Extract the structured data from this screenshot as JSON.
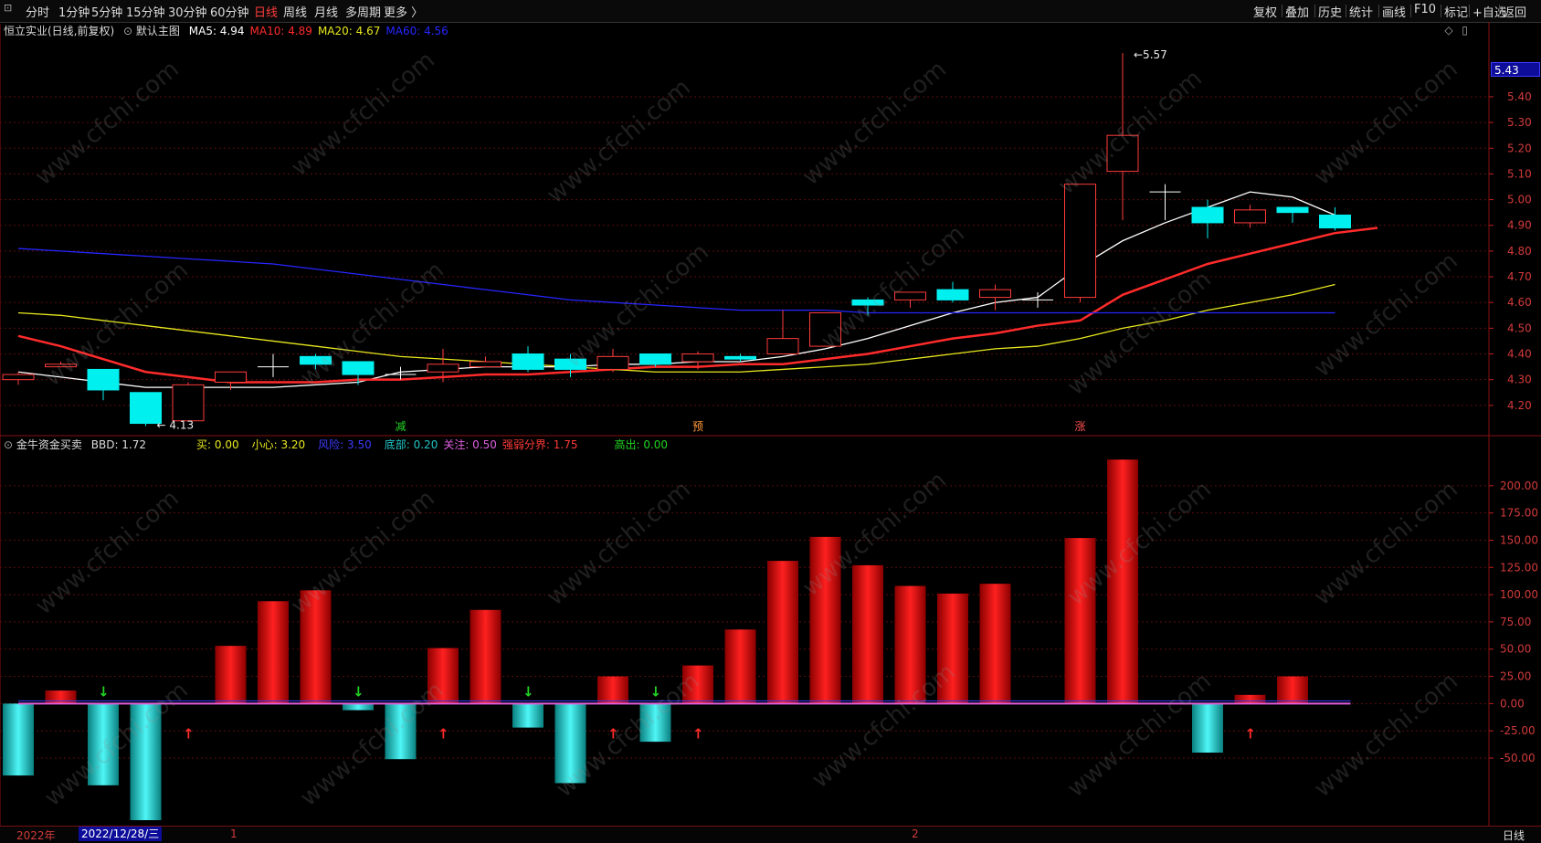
{
  "toolbar": {
    "periods": [
      "分时",
      "1分钟",
      "5分钟",
      "15分钟",
      "30分钟",
      "60分钟",
      "日线",
      "周线",
      "月线",
      "多周期",
      "更多 〉"
    ],
    "active_period": "日线",
    "right_buttons": [
      "复权",
      "叠加",
      "历史",
      "统计",
      "画线",
      "F10",
      "标记",
      "+自选",
      "返回"
    ]
  },
  "main_panel": {
    "title": "恒立实业(日线,前复权)",
    "main_chart_label": "默认主图",
    "ma": [
      {
        "label": "MA5: 4.94",
        "color": "#ffffff"
      },
      {
        "label": "MA10: 4.89",
        "color": "#ff2b2b"
      },
      {
        "label": "MA20: 4.67",
        "color": "#e8e81f"
      },
      {
        "label": "MA60: 4.56",
        "color": "#2626ff"
      }
    ],
    "current_price_tag": "5.43",
    "high_label": "5.57",
    "low_label": "4.13",
    "signal_labels": [
      "减",
      "预",
      "涨"
    ]
  },
  "sub_panel": {
    "title": "金牛资金买卖",
    "items": [
      {
        "label": "BBD: 1.72",
        "color": "#dddddd"
      },
      {
        "label": "买: 0.00",
        "color": "#e8e81f"
      },
      {
        "label": "小心: 3.20",
        "color": "#e8e81f"
      },
      {
        "label": "风险: 3.50",
        "color": "#3b3bff"
      },
      {
        "label": "底部: 0.20",
        "color": "#22c7c7"
      },
      {
        "label": "关注: 0.50",
        "color": "#e060e0"
      },
      {
        "label": "强弱分界: 1.75",
        "color": "#ff3b3b"
      },
      {
        "label": "高出: 0.00",
        "color": "#22d422"
      }
    ]
  },
  "bottom_bar": {
    "year_label": "2022年",
    "date_cursor": "2022/12/28/三",
    "month_marks": [
      "1",
      "2"
    ],
    "period_label": "日线"
  },
  "watermark_text": "www.cfchi.com",
  "chart_data": [
    {
      "type": "candlestick",
      "y_ticks": [
        4.2,
        4.3,
        4.4,
        4.5,
        4.6,
        4.7,
        4.8,
        4.9,
        5.0,
        5.1,
        5.2,
        5.3,
        5.4
      ],
      "ylim": [
        4.1,
        5.62
      ],
      "candles": [
        {
          "o": 4.3,
          "c": 4.32,
          "h": 4.33,
          "l": 4.28
        },
        {
          "o": 4.35,
          "c": 4.36,
          "h": 4.37,
          "l": 4.35
        },
        {
          "o": 4.34,
          "c": 4.26,
          "h": 4.34,
          "l": 4.22
        },
        {
          "o": 4.25,
          "c": 4.13,
          "h": 4.25,
          "l": 4.12
        },
        {
          "o": 4.14,
          "c": 4.28,
          "h": 4.29,
          "l": 4.14
        },
        {
          "o": 4.29,
          "c": 4.33,
          "h": 4.33,
          "l": 4.26
        },
        {
          "o": 4.35,
          "c": 4.35,
          "h": 4.4,
          "l": 4.31
        },
        {
          "o": 4.39,
          "c": 4.36,
          "h": 4.4,
          "l": 4.34
        },
        {
          "o": 4.37,
          "c": 4.32,
          "h": 4.37,
          "l": 4.28
        },
        {
          "o": 4.32,
          "c": 4.32,
          "h": 4.35,
          "l": 4.3
        },
        {
          "o": 4.33,
          "c": 4.36,
          "h": 4.42,
          "l": 4.29
        },
        {
          "o": 4.35,
          "c": 4.37,
          "h": 4.39,
          "l": 4.35
        },
        {
          "o": 4.4,
          "c": 4.34,
          "h": 4.43,
          "l": 4.33
        },
        {
          "o": 4.38,
          "c": 4.34,
          "h": 4.4,
          "l": 4.31
        },
        {
          "o": 4.34,
          "c": 4.39,
          "h": 4.42,
          "l": 4.33
        },
        {
          "o": 4.4,
          "c": 4.36,
          "h": 4.4,
          "l": 4.35
        },
        {
          "o": 4.37,
          "c": 4.4,
          "h": 4.41,
          "l": 4.34
        },
        {
          "o": 4.39,
          "c": 4.38,
          "h": 4.4,
          "l": 4.37
        },
        {
          "o": 4.4,
          "c": 4.46,
          "h": 4.57,
          "l": 4.4
        },
        {
          "o": 4.43,
          "c": 4.56,
          "h": 4.56,
          "l": 4.43
        },
        {
          "o": 4.61,
          "c": 4.59,
          "h": 4.62,
          "l": 4.55
        },
        {
          "o": 4.61,
          "c": 4.64,
          "h": 4.64,
          "l": 4.58
        },
        {
          "o": 4.65,
          "c": 4.61,
          "h": 4.68,
          "l": 4.6
        },
        {
          "o": 4.62,
          "c": 4.65,
          "h": 4.67,
          "l": 4.57
        },
        {
          "o": 4.61,
          "c": 4.61,
          "h": 4.64,
          "l": 4.58
        },
        {
          "o": 4.62,
          "c": 5.06,
          "h": 5.06,
          "l": 4.6
        },
        {
          "o": 5.11,
          "c": 5.25,
          "h": 5.57,
          "l": 4.92
        },
        {
          "o": 5.03,
          "c": 5.03,
          "h": 5.06,
          "l": 4.92
        },
        {
          "o": 4.97,
          "c": 4.91,
          "h": 5.0,
          "l": 4.85
        },
        {
          "o": 4.91,
          "c": 4.96,
          "h": 4.98,
          "l": 4.89
        },
        {
          "o": 4.97,
          "c": 4.95,
          "h": 4.97,
          "l": 4.91
        },
        {
          "o": 4.94,
          "c": 4.89,
          "h": 4.97,
          "l": 4.88
        }
      ],
      "series": [
        {
          "name": "MA5",
          "color": "#ffffff",
          "values": [
            4.33,
            4.31,
            4.29,
            4.27,
            4.27,
            4.27,
            4.27,
            4.28,
            4.29,
            4.33,
            4.34,
            4.35,
            4.35,
            4.35,
            4.36,
            4.36,
            4.37,
            4.37,
            4.39,
            4.42,
            4.46,
            4.51,
            4.56,
            4.6,
            4.62,
            4.74,
            4.84,
            4.91,
            4.97,
            5.03,
            5.01,
            4.94
          ]
        },
        {
          "name": "MA10",
          "color": "#ff2b2b",
          "values": [
            4.47,
            4.43,
            4.38,
            4.33,
            4.31,
            4.29,
            4.29,
            4.29,
            4.3,
            4.3,
            4.31,
            4.32,
            4.32,
            4.33,
            4.34,
            4.35,
            4.35,
            4.36,
            4.36,
            4.38,
            4.4,
            4.43,
            4.46,
            4.48,
            4.51,
            4.53,
            4.63,
            4.69,
            4.75,
            4.79,
            4.83,
            4.87,
            4.89
          ]
        },
        {
          "name": "MA20",
          "color": "#e8e81f",
          "values": [
            4.56,
            4.55,
            4.53,
            4.51,
            4.49,
            4.47,
            4.45,
            4.43,
            4.41,
            4.39,
            4.38,
            4.37,
            4.36,
            4.35,
            4.34,
            4.33,
            4.33,
            4.33,
            4.34,
            4.35,
            4.36,
            4.38,
            4.4,
            4.42,
            4.43,
            4.46,
            4.5,
            4.53,
            4.57,
            4.6,
            4.63,
            4.67
          ]
        },
        {
          "name": "MA60",
          "color": "#2626ff",
          "values": [
            4.81,
            4.8,
            4.79,
            4.78,
            4.77,
            4.76,
            4.75,
            4.73,
            4.71,
            4.69,
            4.67,
            4.65,
            4.63,
            4.61,
            4.6,
            4.59,
            4.58,
            4.57,
            4.57,
            4.57,
            4.56,
            4.56,
            4.56,
            4.56,
            4.56,
            4.56,
            4.56,
            4.56,
            4.56,
            4.56,
            4.56,
            4.56
          ]
        }
      ]
    },
    {
      "type": "bar",
      "title": "金牛资金买卖",
      "y_ticks": [
        200,
        175,
        150,
        125,
        100,
        75,
        50,
        25,
        0,
        -25,
        -50
      ],
      "ylim": [
        -107,
        225
      ],
      "values": [
        -66,
        12,
        -75,
        -107,
        0,
        53,
        94,
        104,
        -6,
        -51,
        51,
        86,
        -22,
        -73,
        25,
        -35,
        35,
        68,
        131,
        153,
        127,
        108,
        101,
        110,
        0,
        152,
        224,
        0,
        -45,
        8,
        25,
        0
      ],
      "down_arrows_at": [
        2,
        8,
        12,
        15
      ],
      "up_arrows_at": [
        4,
        10,
        14,
        16,
        29
      ]
    }
  ]
}
